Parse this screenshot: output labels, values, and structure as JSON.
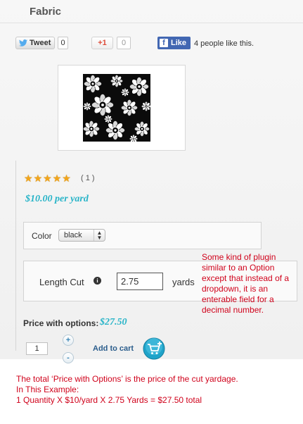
{
  "header": {
    "title": "Fabric"
  },
  "social": {
    "tweet_label": "Tweet",
    "tweet_count": "0",
    "gplus_label": "+1",
    "gplus_count": "0",
    "fb_label": "Like",
    "fb_text": "4 people like this."
  },
  "product": {
    "image_icon": "fabric-floral-swatch",
    "rating_stars": 5,
    "rating_count": "( 1 )",
    "price": "$10.00 per yard"
  },
  "options": {
    "color_label": "Color",
    "color_value": "black",
    "length_label": "Length Cut",
    "length_value": "2.75",
    "length_unit": "yards"
  },
  "totals": {
    "label": "Price with options:",
    "value": "$27.50"
  },
  "cart": {
    "quantity": "1",
    "add_label": "Add to cart"
  },
  "annotations": {
    "right": "Some kind of plugin similar to an Option except that instead of a dropdown, it is an enterable field for a decimal number.",
    "bottom": [
      "The total ‘Price with Options’ is the price of the cut yardage.",
      "In This Example:",
      "1 Quantity X $10/yard X 2.75 Yards = $27.50 total"
    ]
  },
  "colors": {
    "price_color": "#28b4c8",
    "annotation_color": "#d0021b",
    "fb_blue": "#4267b2",
    "star_color": "#f2a51a"
  }
}
